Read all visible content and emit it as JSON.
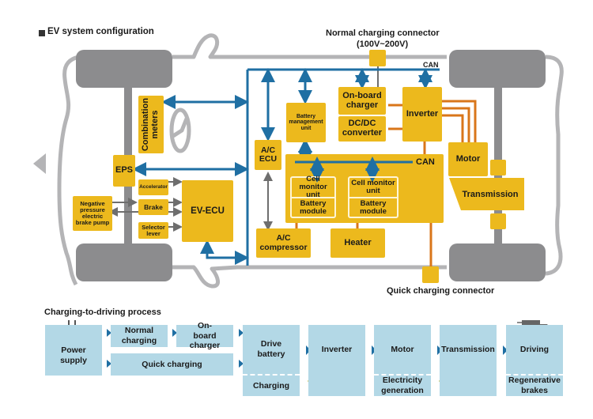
{
  "title": "EV system configuration",
  "connectors": {
    "normal": {
      "label": "Normal charging connector",
      "voltage": "(100V~200V)"
    },
    "quick": {
      "label": "Quick charging connector"
    }
  },
  "can_labels": {
    "top": "CAN",
    "battery": "CAN"
  },
  "components": {
    "combination_meters": "Combination meters",
    "eps": "EPS",
    "accelerator": "Accelerator",
    "brake": "Brake",
    "selector_lever": "Selector lever",
    "brake_pump": "Negative pressure electric brake pump",
    "ev_ecu": "EV-ECU",
    "ac_ecu": "A/C ECU",
    "ac_compressor": "A/C compressor",
    "bmu": "Battery management unit",
    "onboard_charger": "On-board charger",
    "dcdc": "DC/DC converter",
    "inverter": "Inverter",
    "motor": "Motor",
    "transmission": "Transmission",
    "heater": "Heater",
    "cell_monitor_1": "Cell monitor unit",
    "battery_module_1": "Battery module",
    "cell_monitor_2": "Cell monitor unit",
    "battery_module_2": "Battery module"
  },
  "process": {
    "title": "Charging-to-driving process",
    "power_supply": "Power supply",
    "normal_charging": "Normal charging",
    "onboard_charger": "On-board charger",
    "quick_charging": "Quick charging",
    "drive_battery": "Drive battery",
    "charging": "Charging",
    "inverter": "Inverter",
    "motor": "Motor",
    "electricity_generation": "Electricity generation",
    "transmission": "Transmission",
    "driving": "Driving",
    "regenerative_brakes": "Regenerative brakes"
  },
  "colors": {
    "component": "#ecb91d",
    "can_bus": "#1f6fa3",
    "power_line": "#d9761a",
    "signal_line": "#6e6e6e",
    "chassis": "#8c8c8e",
    "body_outline": "#b4b4b6",
    "process_box": "#b3d8e6",
    "forward_arrow": "#1f6fa3",
    "regen_arrow": "#b4b024"
  }
}
